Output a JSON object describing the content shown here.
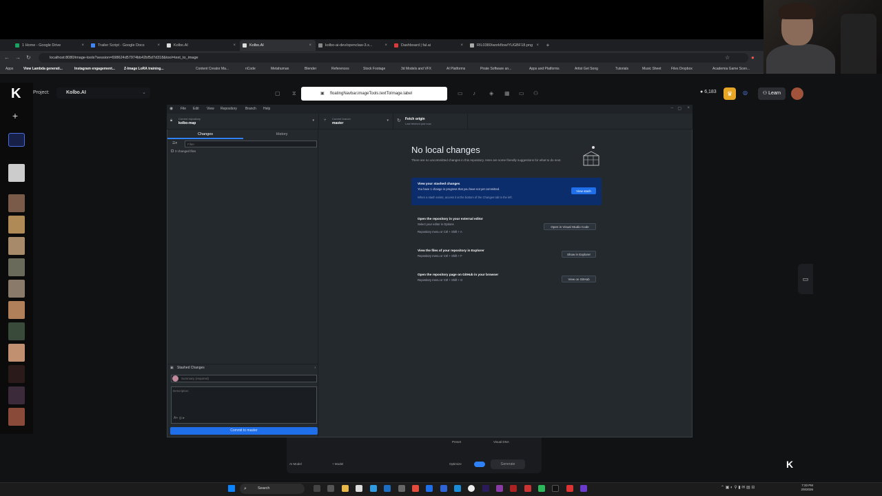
{
  "browser": {
    "tabs": [
      {
        "label": "1 Home - Google Drive",
        "color": "#1aa260"
      },
      {
        "label": "Trailer Script - Google Docs",
        "color": "#4285f4"
      },
      {
        "label": "Kolbo.AI",
        "color": "#ffffff"
      },
      {
        "label": "Kolbo.AI",
        "color": "#ffffff"
      },
      {
        "label": "kolbo-ai-dev/openclaw-3.x...",
        "color": "#888888"
      },
      {
        "label": "Dashboard | fal.ai",
        "color": "#d83b3b"
      },
      {
        "label": "RIL0380/workflow/YUGBF18.png",
        "color": "#aaaaaa"
      }
    ],
    "url": "localhost:8080/image-tools?session=698624d57974bb42bf5d7d318&tool=text_to_image",
    "bookmarks": [
      "Apps",
      "View Lambda generati...",
      "Instagram engagement...",
      "Z-Image LoRA training...",
      "Content Creator Ma...",
      "nCode",
      "Metahuman",
      "Blender",
      "References",
      "Stock Footage",
      "3d Models and VFX",
      "AI Platforms",
      "Pirate Software an...",
      "Apps and Platforms",
      "Artist Get Song",
      "Tutorials",
      "Music Sheet",
      "Files Dropbox",
      "Academia Game Scen..."
    ]
  },
  "kolbo": {
    "logo": "K",
    "project_label": "Project:",
    "project_name": "Kolbo.AI",
    "floating_input": "floatingNavbar.imageTools.textToImage.label",
    "credits": "6,183",
    "learn_label": "Learn",
    "add_label": "+",
    "bottom_preset": "Preset",
    "bottom_visual_dna": "Visual DNA",
    "bottom_ai_model": "AI Model",
    "bottom_model": "Model",
    "bottom_optimize": "Optimize",
    "bottom_generate": "Generate",
    "optimize_on": true
  },
  "github": {
    "menu": [
      "File",
      "Edit",
      "View",
      "Repository",
      "Branch",
      "Help"
    ],
    "current_repository_label": "Current repository",
    "current_repository": "kolbo-map",
    "current_branch_label": "Current branch",
    "current_branch": "master",
    "fetch_label": "Fetch origin",
    "fetch_sub": "Last fetched just now",
    "tab_changes": "Changes",
    "tab_history": "History",
    "filter_placeholder": "Filter",
    "changed_files": "0 changed files",
    "stashed_changes": "Stashed Changes",
    "summary_placeholder": "Summary (required)",
    "description_placeholder": "Description",
    "commit_button": "Commit to master",
    "no_changes_title": "No local changes",
    "no_changes_sub": "There are no uncommitted changes in this repository. Here are some friendly suggestions for what to do next.",
    "cards": [
      {
        "title": "View your stashed changes",
        "sub1": "You have 1 change in progress that you have not yet committed.",
        "sub2": "When a stash exists, access it at the bottom of the Changes tab to the left.",
        "button": "View stash"
      },
      {
        "title": "Open the repository in your external editor",
        "sub1": "Select your editor in Options",
        "sub2": "Repository menu or  Ctrl + Shift + A",
        "button": "Open in Visual Studio Code"
      },
      {
        "title": "View the files of your repository in Explorer",
        "sub1": "Repository menu or  Ctrl + Shift + F",
        "sub2": "",
        "button": "Show in Explorer"
      },
      {
        "title": "Open the repository page on GitHub in your browser",
        "sub1": "Repository menu or  Ctrl + Shift + G",
        "sub2": "",
        "button": "View on GitHub"
      }
    ]
  },
  "taskbar": {
    "search": "Search",
    "time": "7:33 PM",
    "date": "2/8/2026"
  }
}
